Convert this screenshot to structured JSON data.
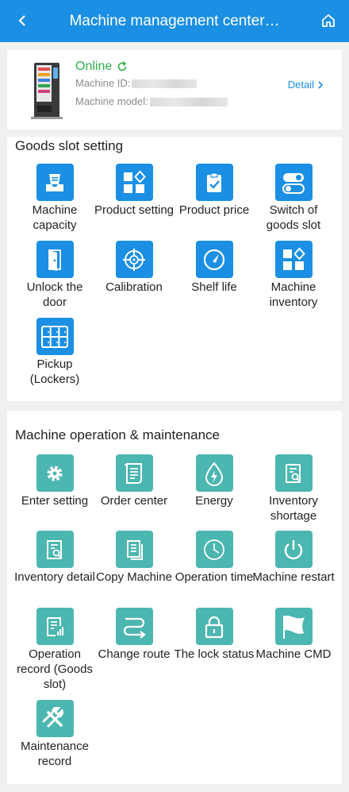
{
  "header": {
    "title": "Machine management center…",
    "back_icon": "chevron-left-icon",
    "home_icon": "home-icon"
  },
  "machine": {
    "status": "Online",
    "id_label": "Machine ID:",
    "model_label": "Machine model:",
    "detail_label": "Detail"
  },
  "goods_slot": {
    "title": "Goods slot setting",
    "items": [
      {
        "label": "Machine capacity",
        "icon": "tray-icon"
      },
      {
        "label": "Product setting",
        "icon": "grid-diamond-icon"
      },
      {
        "label": "Product price",
        "icon": "clipboard-check-icon"
      },
      {
        "label": "Switch of goods slot",
        "icon": "toggle-icon"
      },
      {
        "label": "Unlock the door",
        "icon": "door-icon"
      },
      {
        "label": "Calibration",
        "icon": "crosshair-icon"
      },
      {
        "label": "Shelf life",
        "icon": "gauge-icon"
      },
      {
        "label": "Machine inventory",
        "icon": "grid-diamond-icon"
      },
      {
        "label": "Pickup (Lockers)",
        "icon": "lockers-icon"
      }
    ]
  },
  "operation": {
    "title": "Machine operation & maintenance",
    "items": [
      {
        "label": "Enter setting",
        "icon": "gear-icon"
      },
      {
        "label": "Order center",
        "icon": "scroll-icon"
      },
      {
        "label": "Energy",
        "icon": "energy-drop-icon"
      },
      {
        "label": "Inventory shortage",
        "icon": "doc-search-icon"
      },
      {
        "label": "Inventory detail",
        "icon": "doc-search-icon"
      },
      {
        "label": "Copy Machine",
        "icon": "copy-icon"
      },
      {
        "label": "Operation time",
        "icon": "clock-icon"
      },
      {
        "label": "Machine restart",
        "icon": "power-icon"
      },
      {
        "label": "Operation record (Goods slot)",
        "icon": "doc-chart-icon"
      },
      {
        "label": "Change route",
        "icon": "route-icon"
      },
      {
        "label": "The lock status",
        "icon": "lock-icon"
      },
      {
        "label": "Machine CMD",
        "icon": "flag-icon"
      },
      {
        "label": "Maintenance record",
        "icon": "wrench-icon"
      }
    ]
  },
  "colors": {
    "header": "#1a8fe3",
    "online": "#2bb24c",
    "blue_icon": "#1a8fe3",
    "teal_icon": "#4cb6b0"
  }
}
